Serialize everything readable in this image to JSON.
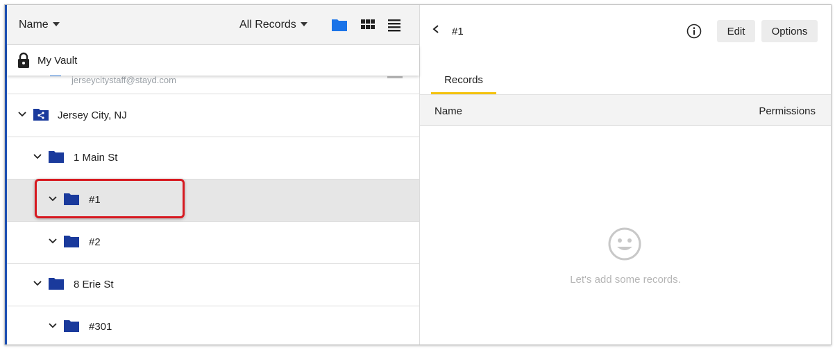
{
  "toolbar": {
    "sort_label": "Name",
    "filter_label": "All Records"
  },
  "vault": {
    "label": "My Vault",
    "partial_email": "jerseycitystaff@stayd.com"
  },
  "tree": {
    "rows": [
      {
        "label": "Jersey City, NJ",
        "type": "shared-folder"
      },
      {
        "label": "1 Main St",
        "type": "folder"
      },
      {
        "label": "#1",
        "type": "folder",
        "selected": true
      },
      {
        "label": "#2",
        "type": "folder"
      },
      {
        "label": "8 Erie St",
        "type": "folder"
      },
      {
        "label": "#301",
        "type": "folder"
      }
    ]
  },
  "detail": {
    "title": "#1",
    "edit_label": "Edit",
    "options_label": "Options",
    "tab_records": "Records",
    "col_name": "Name",
    "col_permissions": "Permissions",
    "empty_message": "Let's add some records."
  },
  "colors": {
    "folder": "#1a3a9c",
    "view_active": "#1a73e8",
    "tab_underline": "#f4c20d",
    "highlight": "#d71920"
  }
}
